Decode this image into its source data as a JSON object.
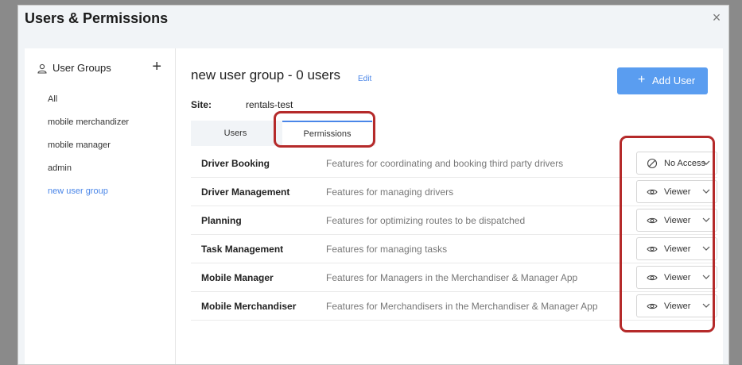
{
  "modal": {
    "title": "Users & Permissions",
    "close_glyph": "×"
  },
  "sidebar": {
    "title": "User Groups",
    "add_glyph": "+",
    "groups": [
      {
        "label": "All"
      },
      {
        "label": "mobile merchandizer"
      },
      {
        "label": "mobile manager"
      },
      {
        "label": "admin"
      },
      {
        "label": "new user group"
      }
    ]
  },
  "header": {
    "group_title": "new user group - 0 users",
    "edit_label": "Edit",
    "site_label": "Site:",
    "site_value": "rentals-test",
    "add_user_plus": "+",
    "add_user_label": "Add User"
  },
  "tabs": [
    {
      "label": "Users"
    },
    {
      "label": "Permissions"
    }
  ],
  "permissions": [
    {
      "name": "Driver Booking",
      "description": "Features for coordinating and booking third party drivers",
      "access": "No Access",
      "icon": "no-access-icon"
    },
    {
      "name": "Driver Management",
      "description": "Features for managing drivers",
      "access": "Viewer",
      "icon": "eye-icon"
    },
    {
      "name": "Planning",
      "description": "Features for optimizing routes to be dispatched",
      "access": "Viewer",
      "icon": "eye-icon"
    },
    {
      "name": "Task Management",
      "description": "Features for managing tasks",
      "access": "Viewer",
      "icon": "eye-icon"
    },
    {
      "name": "Mobile Manager",
      "description": "Features for Managers in the Merchandiser & Manager App",
      "access": "Viewer",
      "icon": "eye-icon"
    },
    {
      "name": "Mobile Merchandiser",
      "description": "Features for Merchandisers in the Merchandiser & Manager App",
      "access": "Viewer",
      "icon": "eye-icon"
    }
  ],
  "colors": {
    "accent": "#4a86e8",
    "button": "#5a9df0",
    "highlight": "#b52a2a",
    "backdrop": "#8a8a8a"
  }
}
